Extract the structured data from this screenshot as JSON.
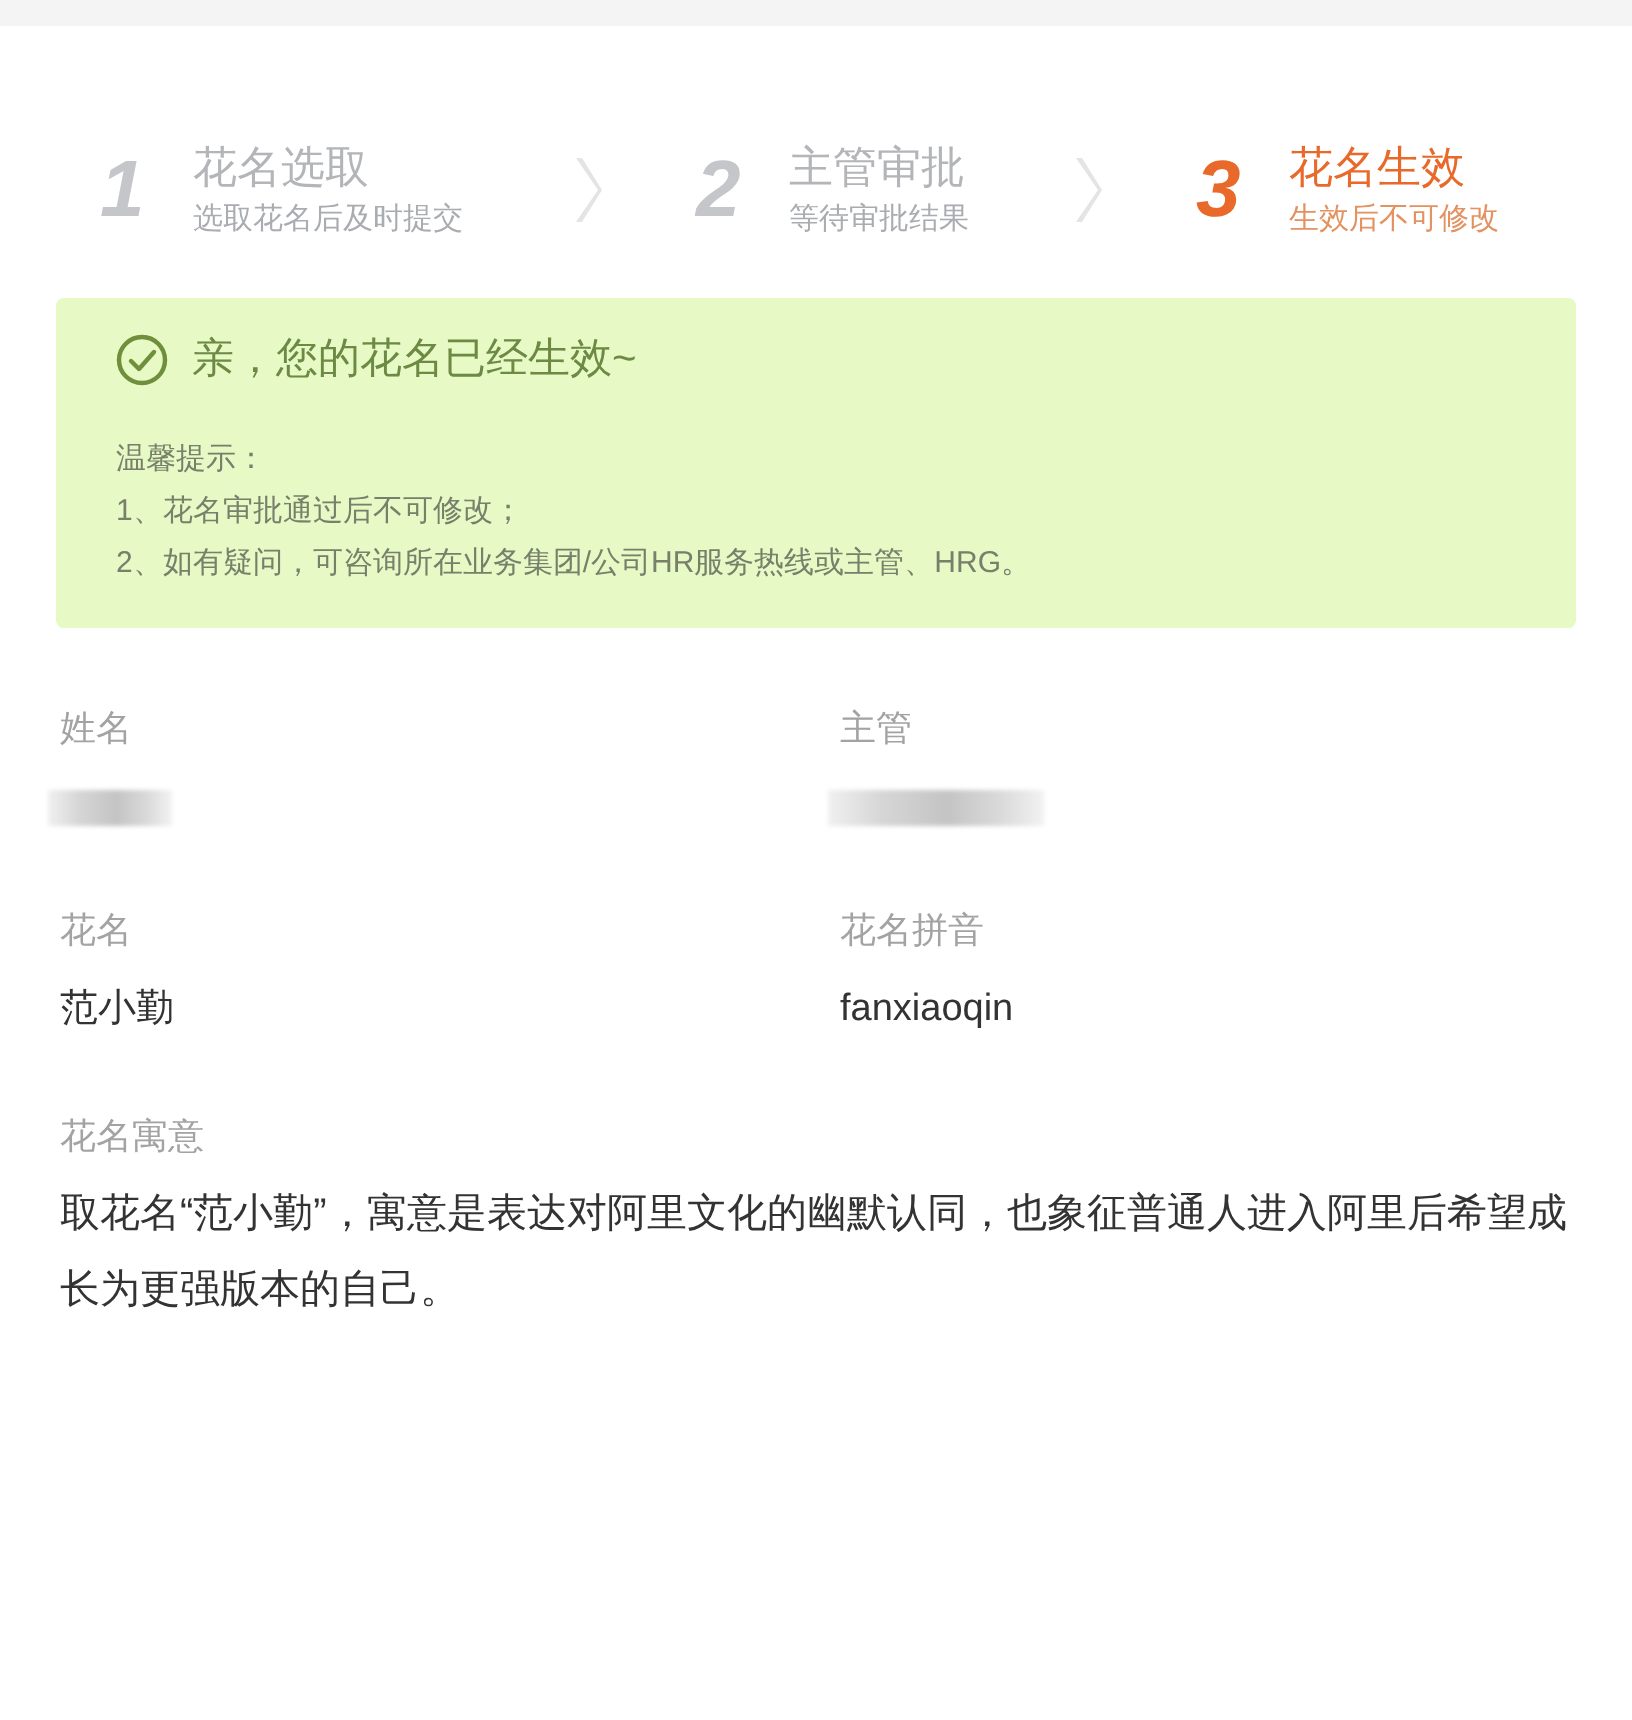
{
  "steps": [
    {
      "number": "1",
      "title": "花名选取",
      "subtitle": "选取花名后及时提交",
      "selected": false
    },
    {
      "number": "2",
      "title": "主管审批",
      "subtitle": "等待审批结果",
      "selected": false
    },
    {
      "number": "3",
      "title": "花名生效",
      "subtitle": "生效后不可修改",
      "selected": true
    }
  ],
  "notice": {
    "title": "亲，您的花名已经生效~",
    "tips_heading": "温馨提示：",
    "tips": [
      "1、花名审批通过后不可修改；",
      "2、如有疑问，可咨询所在业务集团/公司HR服务热线或主管、HRG。"
    ]
  },
  "fields": [
    {
      "label": "姓名",
      "redacted": true
    },
    {
      "label": "主管",
      "redacted": true
    },
    {
      "label": "花名",
      "redacted": false,
      "value": "范小勤"
    },
    {
      "label": "花名拼音",
      "redacted": false,
      "value": "fanxiaoqin"
    }
  ],
  "meaning": {
    "label": "花名寓意",
    "text": "取花名“范小勤”，寓意是表达对阿里文化的幽默认同，也象征普通人进入阿里后希望成长为更强版本的自己。"
  }
}
